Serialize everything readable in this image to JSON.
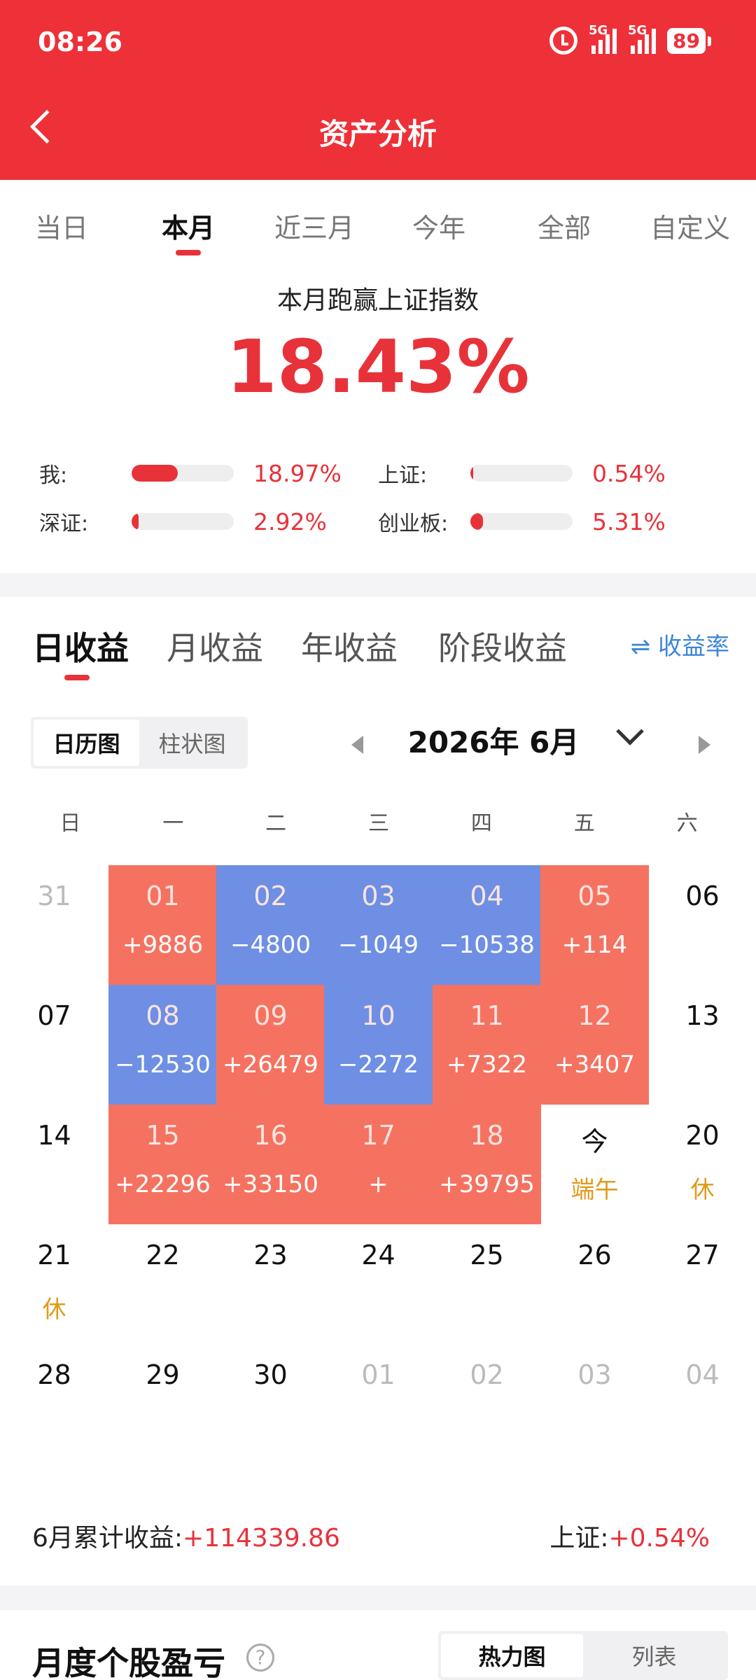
{
  "status": {
    "time": "08:26",
    "signal1": "5G",
    "signal2": "5G",
    "battery": "89"
  },
  "header": {
    "title": "资产分析"
  },
  "period_tabs": [
    "当日",
    "本月",
    "近三月",
    "今年",
    "全部",
    "自定义"
  ],
  "beat": {
    "title": "本月跑赢上证指数",
    "value": "18.43%",
    "rows": [
      {
        "label": "我:",
        "value": "18.97%",
        "fill": 0.45
      },
      {
        "label": "上证:",
        "value": "0.54%",
        "fill": 0.02
      },
      {
        "label": "深证:",
        "value": "2.92%",
        "fill": 0.07
      },
      {
        "label": "创业板:",
        "value": "5.31%",
        "fill": 0.12
      }
    ]
  },
  "earn_tabs": [
    "日收益",
    "月收益",
    "年收益",
    "阶段收益"
  ],
  "rate_toggle": "⇌ 收益率",
  "view_toggle": [
    "日历图",
    "柱状图"
  ],
  "calendar": {
    "month_label": "2026年 6月",
    "weekdays": [
      "日",
      "一",
      "二",
      "三",
      "四",
      "五",
      "六"
    ],
    "weeks": [
      [
        {
          "d": "31",
          "t": "other"
        },
        {
          "d": "01",
          "a": "+9886",
          "t": "pos"
        },
        {
          "d": "02",
          "a": "−4800",
          "t": "neg"
        },
        {
          "d": "03",
          "a": "−1049",
          "t": "neg"
        },
        {
          "d": "04",
          "a": "−10538",
          "t": "neg"
        },
        {
          "d": "05",
          "a": "+114",
          "t": "pos"
        },
        {
          "d": "06",
          "t": "plain"
        }
      ],
      [
        {
          "d": "07",
          "t": "plain"
        },
        {
          "d": "08",
          "a": "−12530",
          "t": "neg"
        },
        {
          "d": "09",
          "a": "+26479",
          "t": "pos"
        },
        {
          "d": "10",
          "a": "−2272",
          "t": "neg"
        },
        {
          "d": "11",
          "a": "+7322",
          "t": "pos"
        },
        {
          "d": "12",
          "a": "+3407",
          "t": "pos"
        },
        {
          "d": "13",
          "t": "plain"
        }
      ],
      [
        {
          "d": "14",
          "t": "plain"
        },
        {
          "d": "15",
          "a": "+22296",
          "t": "pos"
        },
        {
          "d": "16",
          "a": "+33150",
          "t": "pos"
        },
        {
          "d": "17",
          "a": "+",
          "t": "pos"
        },
        {
          "d": "18",
          "a": "+39795",
          "t": "pos"
        },
        {
          "d": "今",
          "n": "端午",
          "t": "plain"
        },
        {
          "d": "20",
          "n": "休",
          "t": "plain"
        }
      ],
      [
        {
          "d": "21",
          "n": "休",
          "t": "plain"
        },
        {
          "d": "22",
          "t": "plain"
        },
        {
          "d": "23",
          "t": "plain"
        },
        {
          "d": "24",
          "t": "plain"
        },
        {
          "d": "25",
          "t": "plain"
        },
        {
          "d": "26",
          "t": "plain"
        },
        {
          "d": "27",
          "t": "plain"
        }
      ],
      [
        {
          "d": "28",
          "t": "plain"
        },
        {
          "d": "29",
          "t": "plain"
        },
        {
          "d": "30",
          "t": "plain"
        },
        {
          "d": "01",
          "t": "other"
        },
        {
          "d": "02",
          "t": "other"
        },
        {
          "d": "03",
          "t": "other"
        },
        {
          "d": "04",
          "t": "other"
        }
      ]
    ]
  },
  "summary": {
    "label": "6月累计收益:",
    "value": "+114339.86",
    "index_label": "上证:",
    "index_value": "+0.54%"
  },
  "bottom": {
    "title": "月度个股盈亏",
    "help": "?",
    "toggle": [
      "热力图",
      "列表"
    ]
  },
  "colors": {
    "brand_red": "#ee3038",
    "gain": "#f57261",
    "loss": "#6e8fe3",
    "holiday": "#e09a1a",
    "link": "#3d86d8"
  }
}
